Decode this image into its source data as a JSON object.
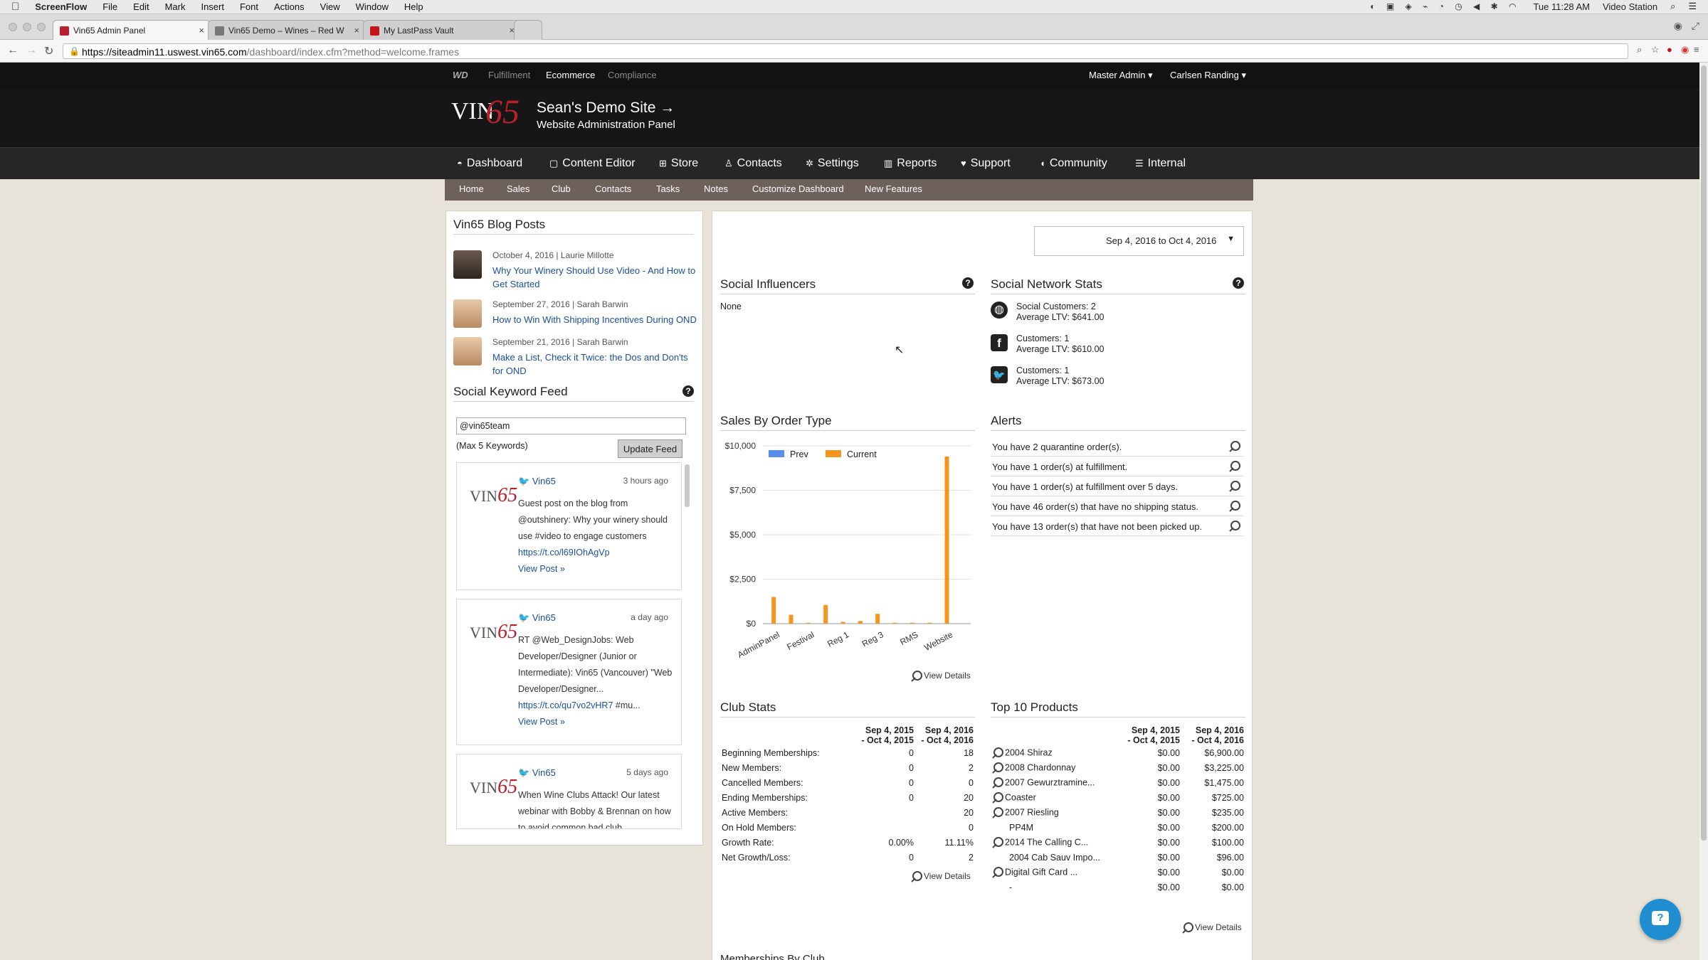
{
  "mac": {
    "app": "ScreenFlow",
    "menus": [
      "File",
      "Edit",
      "Mark",
      "Insert",
      "Font",
      "Actions",
      "View",
      "Window",
      "Help"
    ],
    "clock": "Tue 11:28 AM",
    "station": "Video Station"
  },
  "browser": {
    "tabs": [
      {
        "label": "Vin65 Admin Panel"
      },
      {
        "label": "Vin65 Demo – Wines – Red W"
      },
      {
        "label": "My LastPass Vault"
      }
    ],
    "url_host": "https://siteadmin11.uswest.vin65.com",
    "url_path": "/dashboard/index.cfm?method=welcome.frames"
  },
  "header": {
    "brand_mark": "WD",
    "subnav": [
      "Fulfillment",
      "Ecommerce",
      "Compliance"
    ],
    "account": "Master Admin ▾",
    "winery": "Carlsen Randing ▾",
    "logo_text": "VIN",
    "logo_num": "65",
    "site_name": "Sean's Demo Site →",
    "site_sub": "Website Administration Panel"
  },
  "mainnav": [
    "Dashboard",
    "Content Editor",
    "Store",
    "Contacts",
    "Settings",
    "Reports",
    "Support",
    "Community",
    "Internal"
  ],
  "subnav": [
    "Home",
    "Sales",
    "Club",
    "Contacts",
    "Tasks",
    "Notes",
    "Customize Dashboard",
    "New Features"
  ],
  "blog": {
    "title": "Vin65 Blog Posts",
    "posts": [
      {
        "date": "October 4, 2016  |  Laurie Millotte",
        "title": "Why Your Winery Should Use Video - And How to Get Started"
      },
      {
        "date": "September 27, 2016  |  Sarah Barwin",
        "title": "How to Win With Shipping Incentives During OND"
      },
      {
        "date": "September 21, 2016  |  Sarah Barwin",
        "title": "Make a List, Check it Twice: the Dos and Don'ts for OND"
      }
    ]
  },
  "feed": {
    "title": "Social Keyword Feed",
    "keyword": "@vin65team",
    "max_note": "(Max 5 Keywords)",
    "update_label": "Update Feed",
    "items": [
      {
        "user": "Vin65",
        "time": "3 hours ago",
        "text": "Guest post on the blog from @outshinery: Why your winery should use #video to engage customers",
        "link": "https://t.co/l69IOhAgVp",
        "view": "View Post »"
      },
      {
        "user": "Vin65",
        "time": "a day ago",
        "text": "RT @Web_DesignJobs: Web Developer/Designer (Junior or Intermediate): Vin65 (Vancouver) \"Web Developer/Designer...",
        "link": "https://t.co/qu7vo2vHR7",
        "tail": " #mu...",
        "view": "View Post »"
      },
      {
        "user": "Vin65",
        "time": "5 days ago",
        "text": "When Wine Clubs Attack! Our latest webinar with Bobby & Brennan on how to avoid common bad club"
      }
    ]
  },
  "daterange": "Sep 4, 2016 to Oct 4, 2016",
  "influencers": {
    "title": "Social Influencers",
    "value": "None"
  },
  "network": {
    "title": "Social Network Stats",
    "rows": [
      {
        "l1": "Social Customers: 2",
        "l2": "Average LTV: $641.00"
      },
      {
        "l1": "Customers: 1",
        "l2": "Average LTV: $610.00"
      },
      {
        "l1": "Customers: 1",
        "l2": "Average LTV: $673.00"
      }
    ]
  },
  "sales": {
    "title": "Sales By Order Type",
    "view": "View Details"
  },
  "chart_data": {
    "type": "bar",
    "categories": [
      "AdminPanel",
      "Festival",
      "Reg 1",
      "Reg 3",
      "RMS",
      "Website"
    ],
    "x": [
      "AdminPanel",
      "",
      "Festival",
      "",
      "Reg 1",
      "",
      "Reg 3",
      "",
      "RMS",
      "",
      "Website",
      ""
    ],
    "series": [
      {
        "name": "Prev",
        "color": "#5b8def",
        "values": [
          0,
          0,
          0,
          0,
          0,
          0,
          0,
          0,
          0,
          0,
          0,
          0
        ]
      },
      {
        "name": "Current",
        "color": "#f7941d",
        "values": [
          1500,
          500,
          50,
          1050,
          100,
          150,
          550,
          50,
          50,
          50,
          9400,
          0
        ]
      }
    ],
    "yticks": [
      "$0",
      "$2,500",
      "$5,000",
      "$7,500",
      "$10,000"
    ],
    "ylim": [
      0,
      10000
    ]
  },
  "alerts": {
    "title": "Alerts",
    "items": [
      "You have 2 quarantine order(s).",
      "You have 1 order(s) at fulfillment.",
      "You have 1 order(s) at fulfillment over 5 days.",
      "You have 46 order(s) that have no shipping status.",
      "You have 13 order(s) that have not been picked up."
    ]
  },
  "club": {
    "title": "Club Stats",
    "col1": [
      "Sep 4, 2015",
      "- Oct 4, 2015"
    ],
    "col2": [
      "Sep 4, 2016",
      "- Oct 4, 2016"
    ],
    "view": "View Details",
    "rows": [
      [
        "Beginning Memberships:",
        "0",
        "18"
      ],
      [
        "New Members:",
        "0",
        "2"
      ],
      [
        "Cancelled Members:",
        "0",
        "0"
      ],
      [
        "Ending Memberships:",
        "0",
        "20"
      ],
      [
        "Active Members:",
        "",
        "20"
      ],
      [
        "On Hold Members:",
        "",
        "0"
      ],
      [
        "Growth Rate:",
        "0.00%",
        "11.11%"
      ],
      [
        "Net Growth/Loss:",
        "0",
        "2"
      ]
    ]
  },
  "top10": {
    "title": "Top 10 Products",
    "col1": [
      "Sep 4, 2015",
      "- Oct 4, 2015"
    ],
    "col2": [
      "Sep 4, 2016",
      "- Oct 4, 2016"
    ],
    "view": "View Details",
    "rows": [
      [
        "2004 Shiraz",
        "$0.00",
        "$6,900.00"
      ],
      [
        "2008 Chardonnay",
        "$0.00",
        "$3,225.00"
      ],
      [
        "2007 Gewurztramine...",
        "$0.00",
        "$1,475.00"
      ],
      [
        "Coaster",
        "$0.00",
        "$725.00"
      ],
      [
        "2007 Riesling",
        "$0.00",
        "$235.00"
      ],
      [
        "PP4M",
        "$0.00",
        "$200.00"
      ],
      [
        "2014 The Calling C...",
        "$0.00",
        "$100.00"
      ],
      [
        "2004 Cab Sauv Impo...",
        "$0.00",
        "$96.00"
      ],
      [
        "Digital Gift Card ...",
        "$0.00",
        "$0.00"
      ],
      [
        "-",
        "$0.00",
        "$0.00"
      ]
    ]
  },
  "bottom_cut": "Memberships By Club"
}
